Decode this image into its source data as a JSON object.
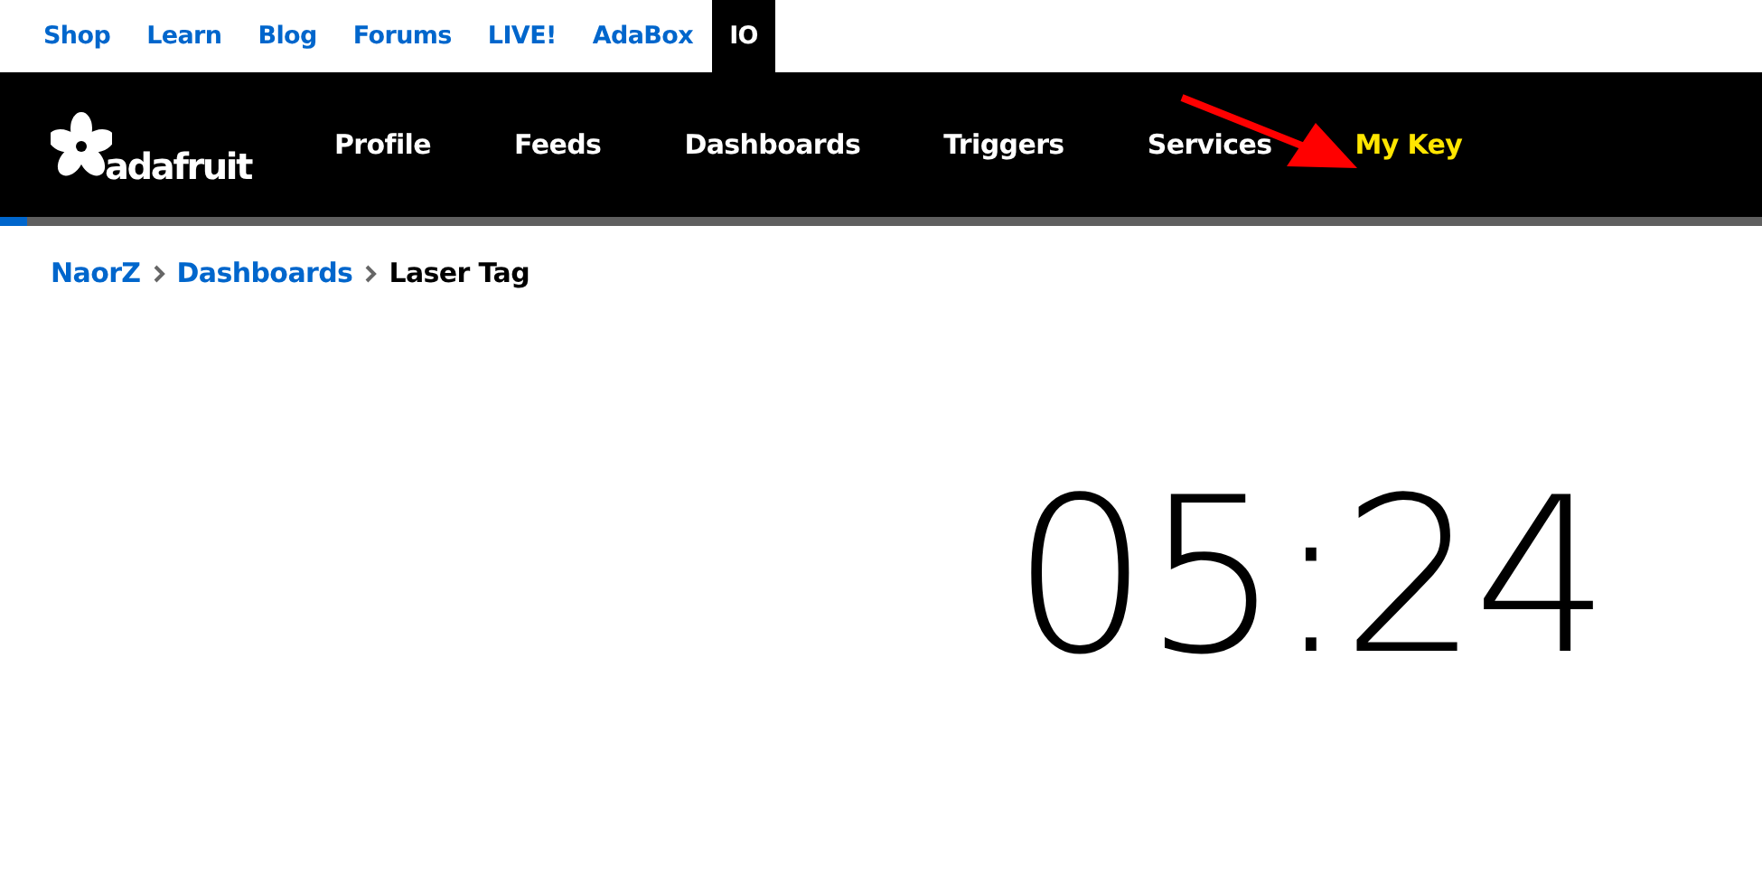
{
  "top_links": [
    {
      "label": "Shop",
      "selected": false
    },
    {
      "label": "Learn",
      "selected": false
    },
    {
      "label": "Blog",
      "selected": false
    },
    {
      "label": "Forums",
      "selected": false
    },
    {
      "label": "LIVE!",
      "selected": false
    },
    {
      "label": "AdaBox",
      "selected": false
    },
    {
      "label": "IO",
      "selected": true
    }
  ],
  "logo": {
    "text": "adafruit"
  },
  "nav": [
    {
      "label": "Profile",
      "selected": false
    },
    {
      "label": "Feeds",
      "selected": false
    },
    {
      "label": "Dashboards",
      "selected": false
    },
    {
      "label": "Triggers",
      "selected": false
    },
    {
      "label": "Services",
      "selected": false
    },
    {
      "label": "My Key",
      "selected": true
    }
  ],
  "annotation": {
    "kind": "arrow"
  },
  "breadcrumb": [
    {
      "label": "NaorZ",
      "kind": "link"
    },
    {
      "label": "Dashboards",
      "kind": "link"
    },
    {
      "label": "Laser Tag",
      "kind": "current"
    }
  ],
  "timer": {
    "value": "05:24"
  }
}
